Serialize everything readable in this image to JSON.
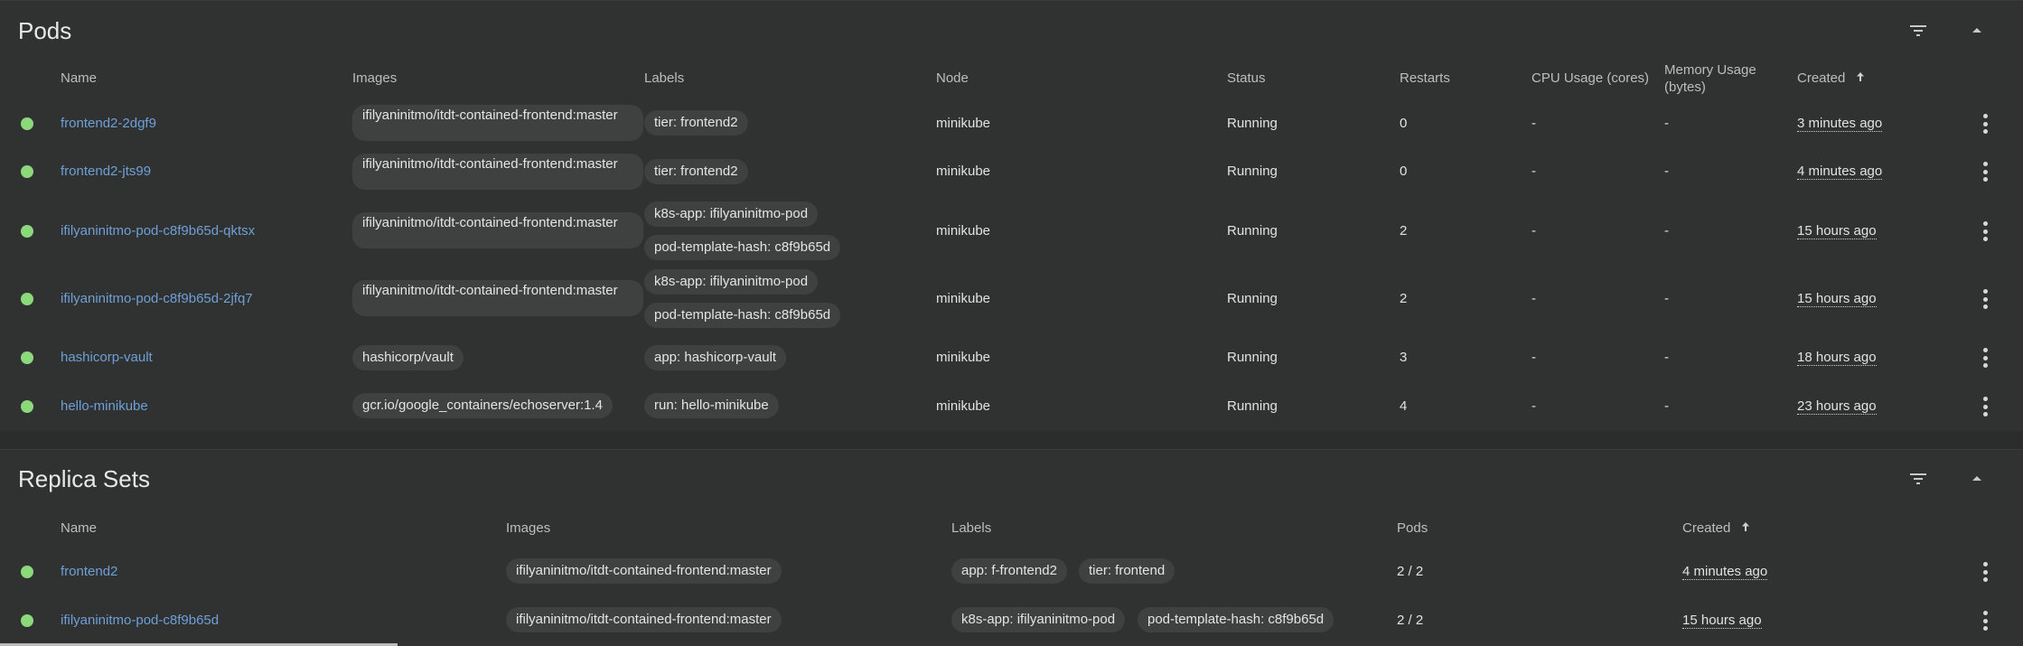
{
  "pods": {
    "title": "Pods",
    "columns": {
      "name": "Name",
      "images": "Images",
      "labels": "Labels",
      "node": "Node",
      "status": "Status",
      "restarts": "Restarts",
      "cpu": "CPU Usage (cores)",
      "memory_line1": "Memory Usage",
      "memory_line2": "(bytes)",
      "created": "Created"
    },
    "rows": [
      {
        "name": "frontend2-2dgf9",
        "image": "ifilyaninitmo/itdt-contained-frontend:master",
        "labels": [
          "tier: frontend2"
        ],
        "node": "minikube",
        "status": "Running",
        "restarts": "0",
        "cpu": "-",
        "memory": "-",
        "created": "3 minutes ago"
      },
      {
        "name": "frontend2-jts99",
        "image": "ifilyaninitmo/itdt-contained-frontend:master",
        "labels": [
          "tier: frontend2"
        ],
        "node": "minikube",
        "status": "Running",
        "restarts": "0",
        "cpu": "-",
        "memory": "-",
        "created": "4 minutes ago"
      },
      {
        "name": "ifilyaninitmo-pod-c8f9b65d-qktsx",
        "image": "ifilyaninitmo/itdt-contained-frontend:master",
        "labels": [
          "k8s-app: ifilyaninitmo-pod",
          "pod-template-hash: c8f9b65d"
        ],
        "node": "minikube",
        "status": "Running",
        "restarts": "2",
        "cpu": "-",
        "memory": "-",
        "created": "15 hours ago"
      },
      {
        "name": "ifilyaninitmo-pod-c8f9b65d-2jfq7",
        "image": "ifilyaninitmo/itdt-contained-frontend:master",
        "labels": [
          "k8s-app: ifilyaninitmo-pod",
          "pod-template-hash: c8f9b65d"
        ],
        "node": "minikube",
        "status": "Running",
        "restarts": "2",
        "cpu": "-",
        "memory": "-",
        "created": "15 hours ago"
      },
      {
        "name": "hashicorp-vault",
        "image": "hashicorp/vault",
        "labels": [
          "app: hashicorp-vault"
        ],
        "node": "minikube",
        "status": "Running",
        "restarts": "3",
        "cpu": "-",
        "memory": "-",
        "created": "18 hours ago"
      },
      {
        "name": "hello-minikube",
        "image": "gcr.io/google_containers/echoserver:1.4",
        "labels": [
          "run: hello-minikube"
        ],
        "node": "minikube",
        "status": "Running",
        "restarts": "4",
        "cpu": "-",
        "memory": "-",
        "created": "23 hours ago"
      }
    ]
  },
  "replica_sets": {
    "title": "Replica Sets",
    "columns": {
      "name": "Name",
      "images": "Images",
      "labels": "Labels",
      "pods": "Pods",
      "created": "Created"
    },
    "rows": [
      {
        "name": "frontend2",
        "image": "ifilyaninitmo/itdt-contained-frontend:master",
        "labels": [
          "app: f-frontend2",
          "tier: frontend"
        ],
        "pods": "2 / 2",
        "created": "4 minutes ago"
      },
      {
        "name": "ifilyaninitmo-pod-c8f9b65d",
        "image": "ifilyaninitmo/itdt-contained-frontend:master",
        "labels": [
          "k8s-app: ifilyaninitmo-pod",
          "pod-template-hash: c8f9b65d"
        ],
        "pods": "2 / 2",
        "created": "15 hours ago"
      }
    ]
  },
  "colors": {
    "background": "#303232",
    "link": "#6f9fd6",
    "status_running": "#8bd97a",
    "chip": "#3f4141"
  },
  "icons": {
    "filter": "filter-icon",
    "collapse": "collapse-icon",
    "sort": "sort-arrow-up-icon",
    "row_menu": "kebab-menu-icon"
  }
}
